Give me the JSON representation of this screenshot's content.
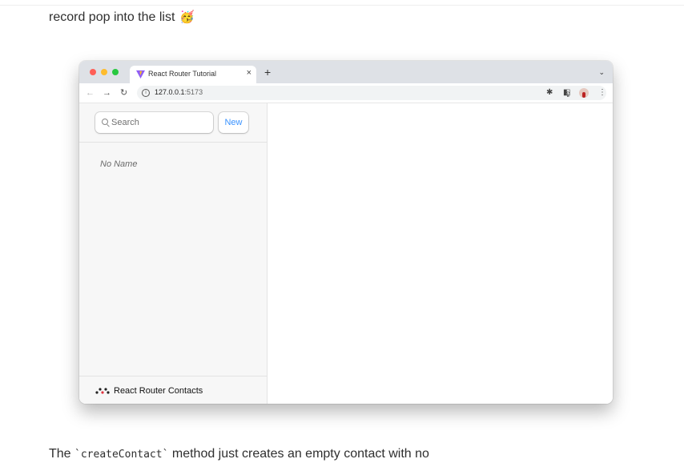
{
  "article": {
    "para1_text": "record pop into the list",
    "para1_emoji": "🥳",
    "para2_before": "The ",
    "para2_code": "`createContact`",
    "para2_after": " method just creates an empty contact with no"
  },
  "browser": {
    "tab_title": "React Router Tutorial",
    "tab_close": "×",
    "new_tab": "+",
    "tab_dropdown": "⌄",
    "nav_back": "←",
    "nav_forward": "→",
    "nav_reload": "↻",
    "url_host": "127.0.0.1",
    "url_port": ":5173",
    "share_icon": "⇪",
    "star_icon": "☆",
    "extensions_icon": "✱",
    "sidepanel_icon": "◧",
    "menu_icon": "⋮"
  },
  "app": {
    "search_placeholder": "Search",
    "new_button": "New",
    "contacts": [
      {
        "name": "No Name"
      }
    ],
    "brand": "React Router Contacts"
  },
  "colors": {
    "accent": "#3992ff",
    "sidebar_bg": "#f7f7f7",
    "tabbar_bg": "#dee1e6"
  }
}
